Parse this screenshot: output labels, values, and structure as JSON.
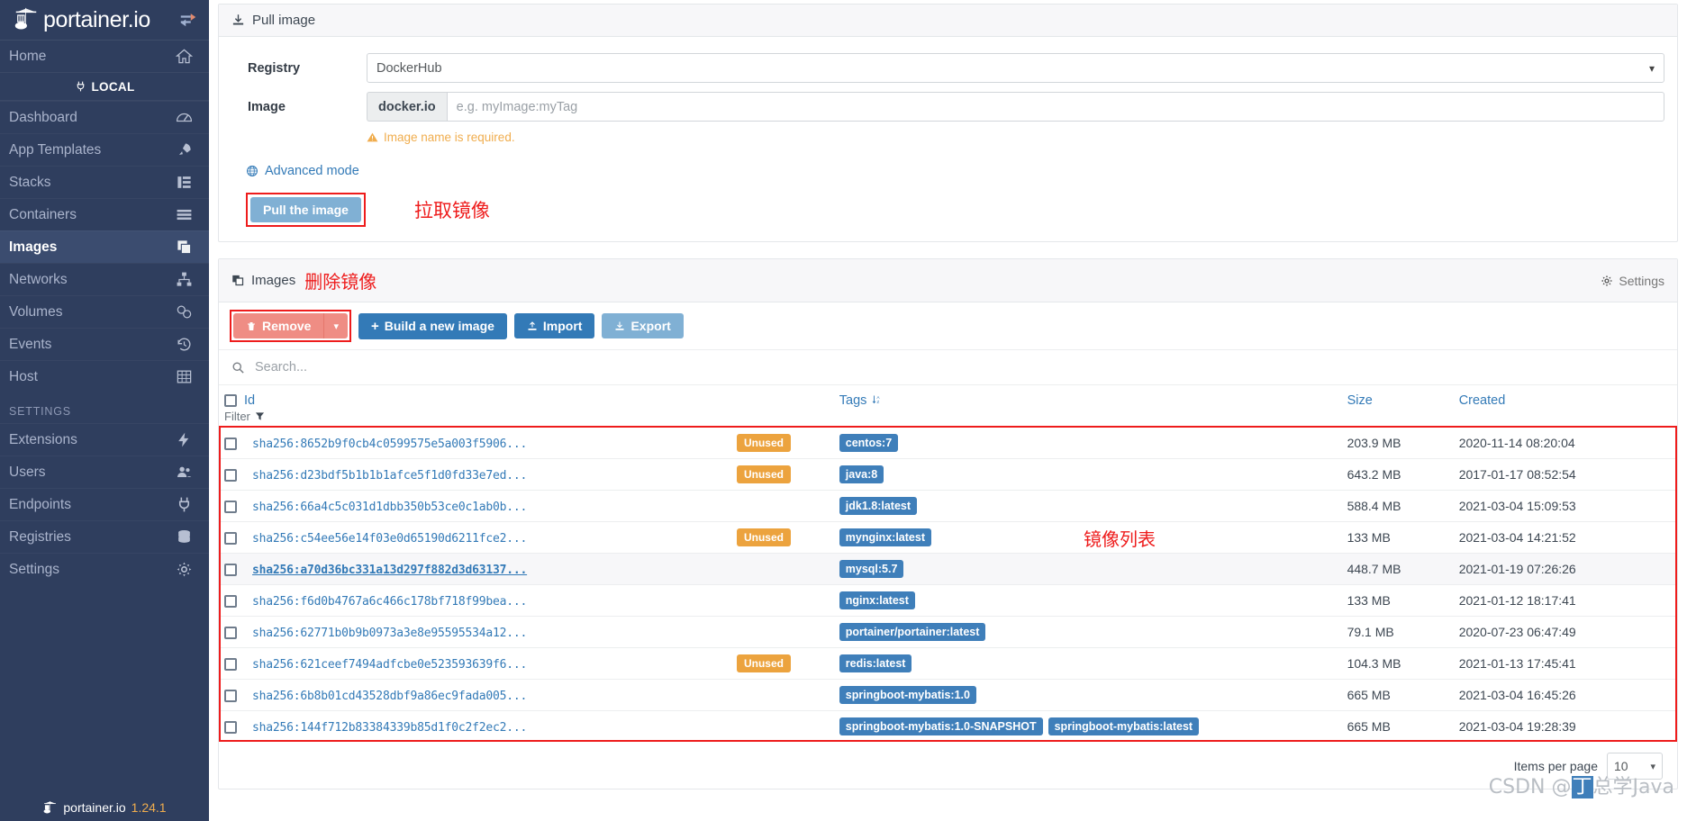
{
  "sidebar": {
    "brand": "portainer.io",
    "toggle_icon": "toggle-sidebar-icon",
    "home_label": "Home",
    "endpoint_label": "LOCAL",
    "items": [
      {
        "label": "Dashboard",
        "icon": "dashboard-icon"
      },
      {
        "label": "App Templates",
        "icon": "rocket-icon"
      },
      {
        "label": "Stacks",
        "icon": "stacks-icon"
      },
      {
        "label": "Containers",
        "icon": "containers-icon"
      },
      {
        "label": "Images",
        "icon": "images-icon"
      },
      {
        "label": "Networks",
        "icon": "networks-icon"
      },
      {
        "label": "Volumes",
        "icon": "volumes-icon"
      },
      {
        "label": "Events",
        "icon": "history-icon"
      },
      {
        "label": "Host",
        "icon": "grid-icon"
      }
    ],
    "section_label": "SETTINGS",
    "settings_items": [
      {
        "label": "Extensions",
        "icon": "bolt-icon"
      },
      {
        "label": "Users",
        "icon": "users-icon"
      },
      {
        "label": "Endpoints",
        "icon": "plug-icon"
      },
      {
        "label": "Registries",
        "icon": "database-icon"
      },
      {
        "label": "Settings",
        "icon": "gear-icon"
      }
    ],
    "footer_brand": "portainer.io",
    "footer_version": "1.24.1"
  },
  "pull_panel": {
    "title": "Pull image",
    "title_icon": "download-icon",
    "registry_label": "Registry",
    "registry_value": "DockerHub",
    "image_label": "Image",
    "image_prefix": "docker.io",
    "image_placeholder": "e.g. myImage:myTag",
    "image_value": "",
    "warning_text": "Image name is required.",
    "warning_icon": "warning-triangle-icon",
    "advanced_label": "Advanced mode",
    "advanced_icon": "globe-icon",
    "pull_button_label": "Pull the image",
    "annotation": "拉取镜像"
  },
  "images_panel": {
    "title": "Images",
    "title_icon": "images-icon",
    "annotation": "删除镜像",
    "settings_label": "Settings",
    "settings_icon": "gear-icon",
    "toolbar": {
      "remove_label": "Remove",
      "remove_icon": "trash-icon",
      "remove_caret_icon": "caret-down-icon",
      "build_label": "Build a new image",
      "build_icon": "plus-icon",
      "import_label": "Import",
      "import_icon": "upload-icon",
      "export_label": "Export",
      "export_icon": "download-icon"
    },
    "search_placeholder": "Search...",
    "search_value": "",
    "search_icon": "search-icon",
    "columns": {
      "id": "Id",
      "filter": "Filter",
      "filter_icon": "funnel-icon",
      "tags": "Tags",
      "tags_sort_icon": "sort-alpha-down-icon",
      "size": "Size",
      "created": "Created"
    },
    "list_annotation": "镜像列表",
    "rows": [
      {
        "id": "sha256:8652b9f0cb4c0599575e5a003f5906...",
        "unused": "Unused",
        "tags": [
          "centos:7"
        ],
        "size": "203.9 MB",
        "created": "2020-11-14 08:20:04",
        "highlighted": false
      },
      {
        "id": "sha256:d23bdf5b1b1b1afce5f1d0fd33e7ed...",
        "unused": "Unused",
        "tags": [
          "java:8"
        ],
        "size": "643.2 MB",
        "created": "2017-01-17 08:52:54",
        "highlighted": false
      },
      {
        "id": "sha256:66a4c5c031d1dbb350b53ce0c1ab0b...",
        "unused": "",
        "tags": [
          "jdk1.8:latest"
        ],
        "size": "588.4 MB",
        "created": "2021-03-04 15:09:53",
        "highlighted": false
      },
      {
        "id": "sha256:c54ee56e14f03e0d65190d6211fce2...",
        "unused": "Unused",
        "tags": [
          "mynginx:latest"
        ],
        "size": "133 MB",
        "created": "2021-03-04 14:21:52",
        "highlighted": false
      },
      {
        "id": "sha256:a70d36bc331a13d297f882d3d63137...",
        "unused": "",
        "tags": [
          "mysql:5.7"
        ],
        "size": "448.7 MB",
        "created": "2021-01-19 07:26:26",
        "highlighted": true
      },
      {
        "id": "sha256:f6d0b4767a6c466c178bf718f99bea...",
        "unused": "",
        "tags": [
          "nginx:latest"
        ],
        "size": "133 MB",
        "created": "2021-01-12 18:17:41",
        "highlighted": false
      },
      {
        "id": "sha256:62771b0b9b0973a3e8e95595534a12...",
        "unused": "",
        "tags": [
          "portainer/portainer:latest"
        ],
        "size": "79.1 MB",
        "created": "2020-07-23 06:47:49",
        "highlighted": false
      },
      {
        "id": "sha256:621ceef7494adfcbe0e523593639f6...",
        "unused": "Unused",
        "tags": [
          "redis:latest"
        ],
        "size": "104.3 MB",
        "created": "2021-01-13 17:45:41",
        "highlighted": false
      },
      {
        "id": "sha256:6b8b01cd43528dbf9a86ec9fada005...",
        "unused": "",
        "tags": [
          "springboot-mybatis:1.0"
        ],
        "size": "665 MB",
        "created": "2021-03-04 16:45:26",
        "highlighted": false
      },
      {
        "id": "sha256:144f712b83384339b85d1f0c2f2ec2...",
        "unused": "",
        "tags": [
          "springboot-mybatis:1.0-SNAPSHOT",
          "springboot-mybatis:latest"
        ],
        "size": "665 MB",
        "created": "2021-03-04 19:28:39",
        "highlighted": false
      }
    ],
    "pager": {
      "items_per_page_label": "Items per page",
      "items_per_page_value": "10"
    }
  },
  "watermark": {
    "prefix": "CSDN @",
    "highlight": "丁",
    "suffix": "总学Java"
  },
  "colors": {
    "sidebar_bg": "#2f3e5e",
    "accent_blue": "#337ab7",
    "tag_blue": "#3f7fba",
    "badge_orange": "#eca33e",
    "danger_red": "#ef8d84",
    "annotation_red": "#ee1c1c",
    "warning_orange": "#f0ad4e"
  }
}
